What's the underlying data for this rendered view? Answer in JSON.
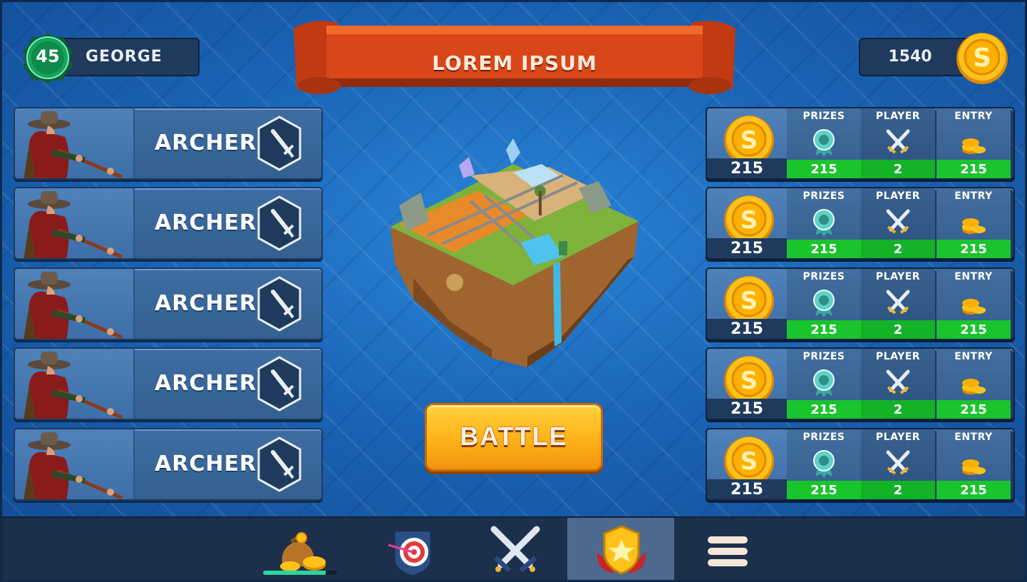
{
  "player": {
    "name": "GEORGE",
    "level": "45"
  },
  "banner": {
    "title": "LOREM IPSUM"
  },
  "wallet": {
    "coins": "1540"
  },
  "archers": [
    {
      "label": "ARCHER"
    },
    {
      "label": "ARCHER"
    },
    {
      "label": "ARCHER"
    },
    {
      "label": "ARCHER"
    },
    {
      "label": "ARCHER"
    }
  ],
  "battle": {
    "label": "BATTLE"
  },
  "tournament_headers": {
    "prizes": "PRIZES",
    "player": "PLAYER",
    "entry": "ENTRY"
  },
  "tournaments": [
    {
      "amount": "215",
      "prizes": "215",
      "player": "2",
      "entry": "215"
    },
    {
      "amount": "215",
      "prizes": "215",
      "player": "2",
      "entry": "215"
    },
    {
      "amount": "215",
      "prizes": "215",
      "player": "2",
      "entry": "215"
    },
    {
      "amount": "215",
      "prizes": "215",
      "player": "2",
      "entry": "215"
    },
    {
      "amount": "215",
      "prizes": "215",
      "player": "2",
      "entry": "215"
    }
  ],
  "nav": {
    "items": [
      {
        "icon": "coin-bag-icon"
      },
      {
        "icon": "target-icon"
      },
      {
        "icon": "crossed-swords-icon"
      },
      {
        "icon": "star-shield-icon",
        "active": true
      },
      {
        "icon": "menu-icon"
      }
    ],
    "shop_progress": 0.85
  },
  "colors": {
    "background": "#1a63b5",
    "panel": "#1f3a5c",
    "green_value": "#19c42c",
    "battle_orange": "#ffb218",
    "banner_red": "#d9461a",
    "coin_gold": "#ffc21a"
  }
}
